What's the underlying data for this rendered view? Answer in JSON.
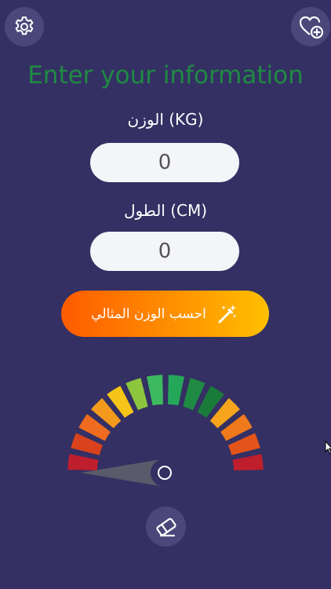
{
  "header": {
    "settings_icon": "gear-icon",
    "favorite_icon": "heart-plus-icon"
  },
  "form": {
    "title": "Enter your information",
    "weight_label": "الوزن (KG)",
    "weight_value": "0",
    "height_label": "الطول (CM)",
    "height_value": "0"
  },
  "calculate_button": {
    "label": "احسب الوزن المثالي",
    "icon": "magic-wand-icon",
    "gradient": [
      "#fe5b00",
      "#ff8c00",
      "#ffc000"
    ]
  },
  "gauge": {
    "segment_colors": [
      "#bf1e2d",
      "#d9421c",
      "#ee6b1f",
      "#f39a1c",
      "#f5c518",
      "#8cc63f",
      "#3dba5f",
      "#25a75a",
      "#1f8a43",
      "#1a7a3a",
      "#f5a41c",
      "#ee7a1c",
      "#e3541a",
      "#bf1e2d"
    ],
    "needle_color": "#5a5a6a",
    "needle_level": 0
  },
  "footer": {
    "eraser_icon": "eraser-icon"
  },
  "colors": {
    "background": "#343063",
    "button_bg": "#4b477a",
    "title": "#1f8a43"
  }
}
